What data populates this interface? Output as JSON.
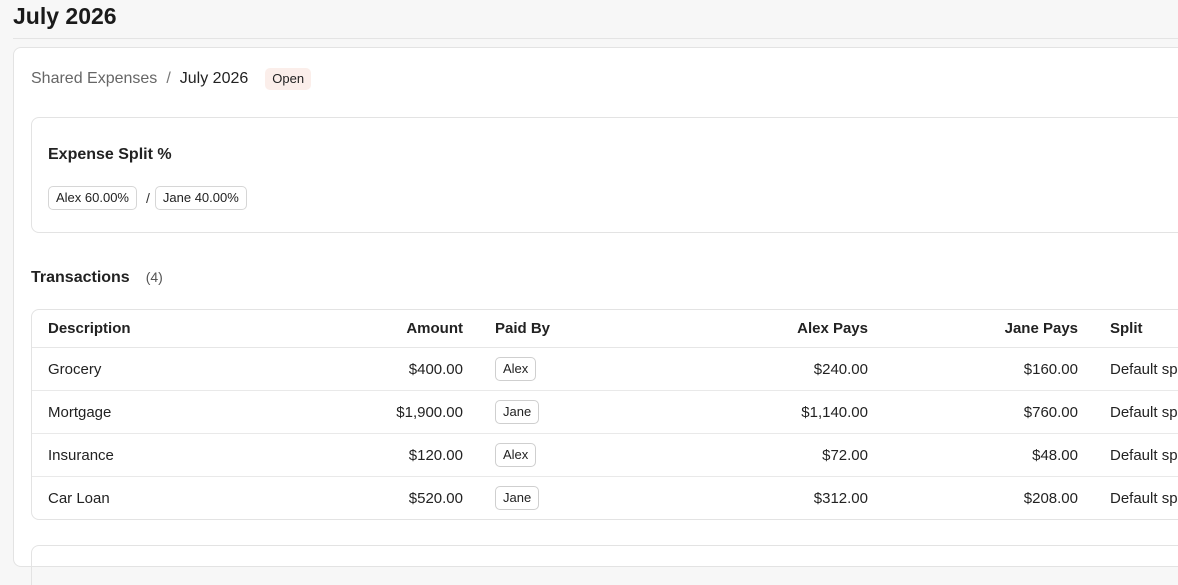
{
  "page": {
    "title": "July 2026"
  },
  "breadcrumb": {
    "root": "Shared Expenses",
    "separator": "/",
    "current": "July 2026",
    "status": "Open"
  },
  "split": {
    "title": "Expense Split %",
    "divider": "/",
    "people": [
      {
        "label": "Alex 60.00%"
      },
      {
        "label": "Jane 40.00%"
      }
    ]
  },
  "transactions": {
    "title": "Transactions",
    "count": "(4)",
    "columns": {
      "description": "Description",
      "amount": "Amount",
      "paid_by": "Paid By",
      "alex_pays": "Alex Pays",
      "jane_pays": "Jane Pays",
      "split": "Split"
    },
    "rows": [
      {
        "description": "Grocery",
        "amount": "$400.00",
        "paid_by": "Alex",
        "alex_pays": "$240.00",
        "jane_pays": "$160.00",
        "split": "Default split"
      },
      {
        "description": "Mortgage",
        "amount": "$1,900.00",
        "paid_by": "Jane",
        "alex_pays": "$1,140.00",
        "jane_pays": "$760.00",
        "split": "Default split"
      },
      {
        "description": "Insurance",
        "amount": "$120.00",
        "paid_by": "Alex",
        "alex_pays": "$72.00",
        "jane_pays": "$48.00",
        "split": "Default split"
      },
      {
        "description": "Car Loan",
        "amount": "$520.00",
        "paid_by": "Jane",
        "alex_pays": "$312.00",
        "jane_pays": "$208.00",
        "split": "Default split"
      }
    ]
  },
  "colors": {
    "background": "#f7f7f7",
    "card": "#ffffff",
    "border": "#e3e3e3",
    "status_badge": "#fbeeea"
  }
}
